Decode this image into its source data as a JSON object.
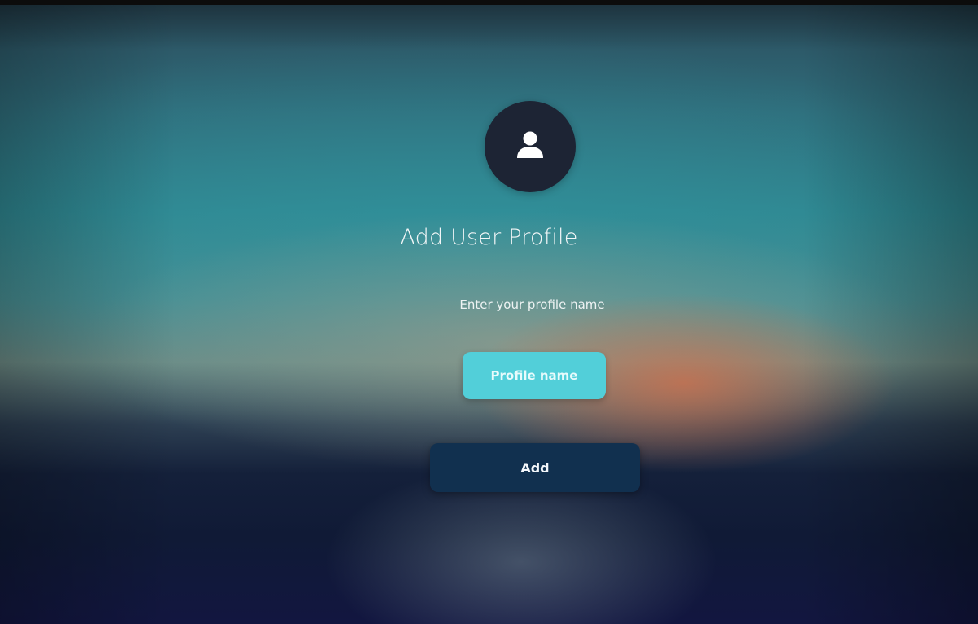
{
  "avatar": {
    "icon": "person-icon"
  },
  "title": "Add User Profile",
  "subtitle": "Enter your profile name",
  "profile_input": {
    "placeholder": "Profile name",
    "value": ""
  },
  "add_button": {
    "label": "Add"
  },
  "colors": {
    "avatar_bg": "#1d2434",
    "input_bg": "#52cfd9",
    "button_bg": "#11304f"
  }
}
